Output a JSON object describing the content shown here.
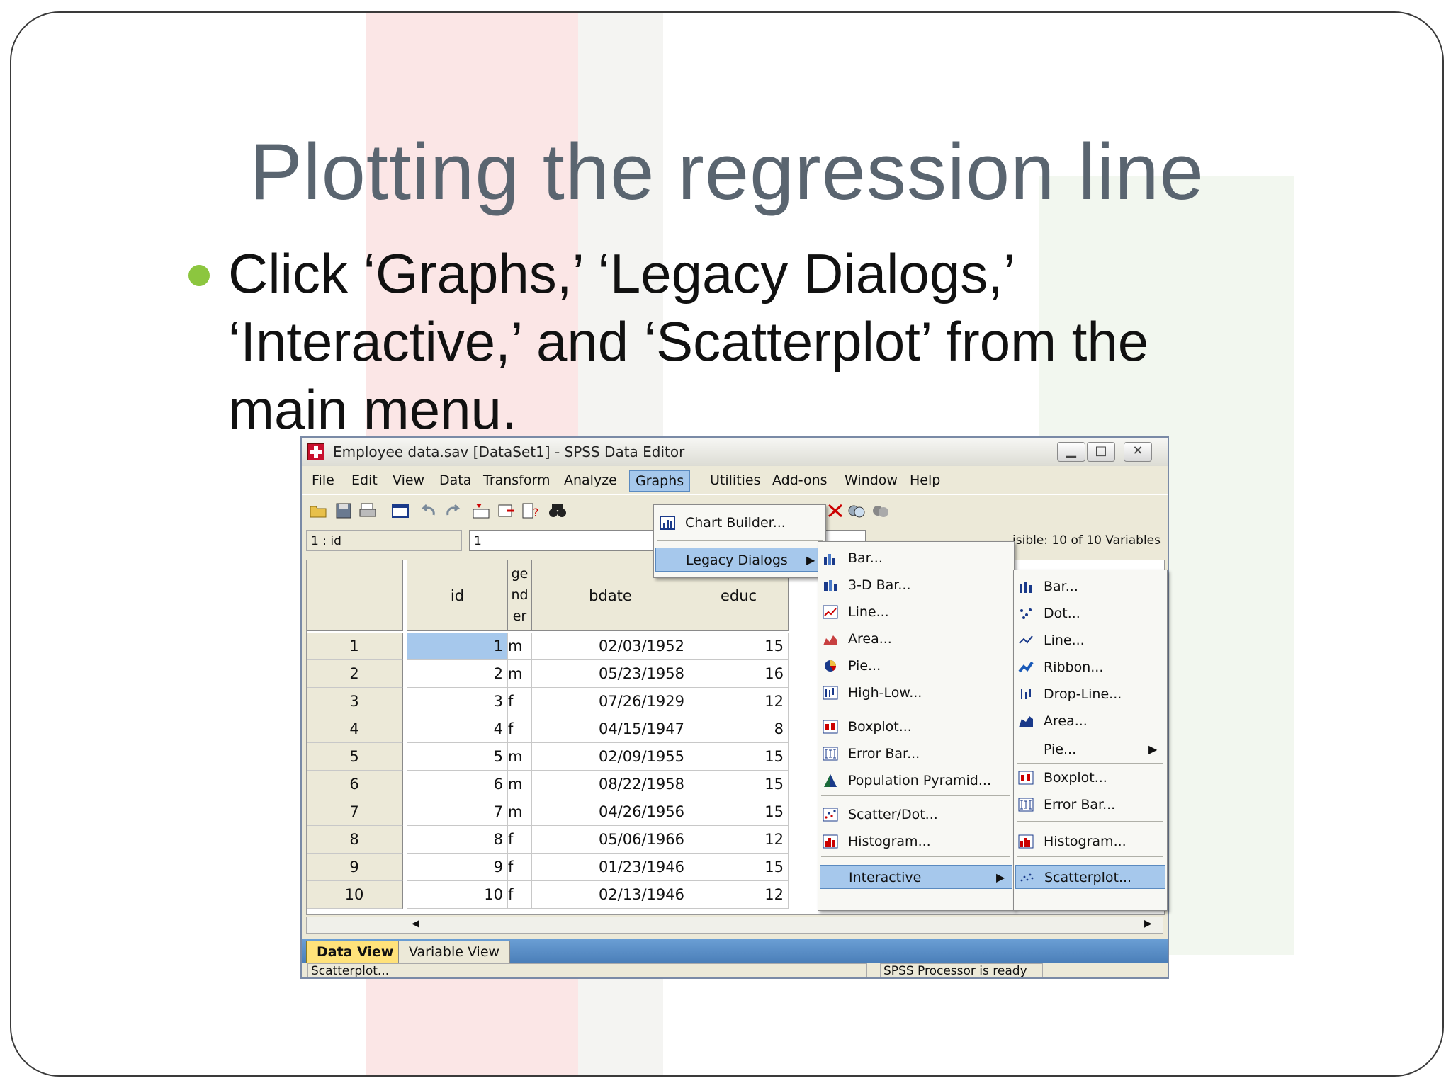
{
  "slide": {
    "title": "Plotting the regression line",
    "bullet_lines": [
      "Click ‘Graphs,’ ‘Legacy Dialogs,’",
      "‘Interactive,’  and ‘Scatterplot’ from the",
      "main menu."
    ],
    "bullet_color": "#8cc63f"
  },
  "window": {
    "title": "Employee data.sav [DataSet1] - SPSS Data Editor",
    "controls": {
      "minimize": "▁",
      "maximize": "□",
      "close": "✕"
    },
    "menu": [
      "File",
      "Edit",
      "View",
      "Data",
      "Transform",
      "Analyze",
      "Graphs",
      "Utilities",
      "Add-ons",
      "Window",
      "Help"
    ],
    "active_menu": "Graphs",
    "cell_ref": "1 : id",
    "cell_value": "1",
    "visible_vars": "isible: 10 of 10 Variables",
    "columns": [
      {
        "name": "id",
        "name_lines": [
          "id"
        ]
      },
      {
        "name": "gender",
        "name_lines": [
          "ge",
          "nd",
          "er"
        ]
      },
      {
        "name": "bdate",
        "name_lines": [
          "bdate"
        ]
      },
      {
        "name": "educ",
        "name_lines": [
          "educ"
        ]
      }
    ],
    "rows": [
      {
        "n": "1",
        "id": "1",
        "gender": "m",
        "bdate": "02/03/1952",
        "educ": "15"
      },
      {
        "n": "2",
        "id": "2",
        "gender": "m",
        "bdate": "05/23/1958",
        "educ": "16"
      },
      {
        "n": "3",
        "id": "3",
        "gender": "f",
        "bdate": "07/26/1929",
        "educ": "12"
      },
      {
        "n": "4",
        "id": "4",
        "gender": "f",
        "bdate": "04/15/1947",
        "educ": "8"
      },
      {
        "n": "5",
        "id": "5",
        "gender": "m",
        "bdate": "02/09/1955",
        "educ": "15"
      },
      {
        "n": "6",
        "id": "6",
        "gender": "m",
        "bdate": "08/22/1958",
        "educ": "15"
      },
      {
        "n": "7",
        "id": "7",
        "gender": "m",
        "bdate": "04/26/1956",
        "educ": "15"
      },
      {
        "n": "8",
        "id": "8",
        "gender": "f",
        "bdate": "05/06/1966",
        "educ": "12"
      },
      {
        "n": "9",
        "id": "9",
        "gender": "f",
        "bdate": "01/23/1946",
        "educ": "15"
      },
      {
        "n": "10",
        "id": "10",
        "gender": "f",
        "bdate": "02/13/1946",
        "educ": "12"
      }
    ],
    "tabs": {
      "data_view": "Data View",
      "variable_view": "Variable View"
    },
    "status": {
      "left": "Scatterplot...",
      "right": "SPSS  Processor is ready"
    }
  },
  "graphs_menu": {
    "chart_builder": "Chart Builder...",
    "legacy_dialogs": "Legacy Dialogs"
  },
  "legacy_menu": {
    "items": [
      "Bar...",
      "3-D Bar...",
      "Line...",
      "Area...",
      "Pie...",
      "High-Low...",
      "Boxplot...",
      "Error Bar...",
      "Population Pyramid...",
      "Scatter/Dot...",
      "Histogram...",
      "Interactive"
    ],
    "icons": [
      "bar-chart-icon",
      "3d-bar-chart-icon",
      "line-chart-icon",
      "area-chart-icon",
      "pie-chart-icon",
      "high-low-chart-icon",
      "boxplot-icon",
      "error-bar-icon",
      "population-pyramid-icon",
      "scatter-dot-icon",
      "histogram-icon",
      ""
    ]
  },
  "interactive_menu": {
    "items": [
      "Bar...",
      "Dot...",
      "Line...",
      "Ribbon...",
      "Drop-Line...",
      "Area...",
      "Pie...",
      "Boxplot...",
      "Error Bar...",
      "Histogram...",
      "Scatterplot..."
    ],
    "icons": [
      "bar-icon",
      "dot-icon",
      "line-icon",
      "ribbon-icon",
      "drop-line-icon",
      "area-icon",
      "",
      "boxplot-icon",
      "error-bar-icon",
      "histogram-icon",
      "scatterplot-icon"
    ]
  },
  "colors": {
    "highlight": "#a6c8ec",
    "title_gray": "#5a6570",
    "tab_active": "#ffe27a"
  }
}
